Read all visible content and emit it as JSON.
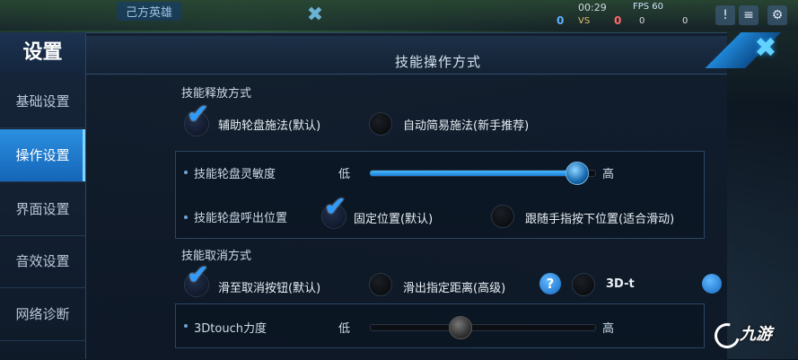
{
  "hud": {
    "ally_text": "己方英雄",
    "time": "00:29",
    "vs": "VS",
    "fps": "FPS 60",
    "score_blue": "0",
    "score_red": "0",
    "stat_a": "0",
    "stat_b": "0"
  },
  "settings": {
    "title": "设置",
    "close_icon": "close-icon",
    "nav": [
      {
        "label": "基础设置"
      },
      {
        "label": "操作设置",
        "active": true
      },
      {
        "label": "界面设置"
      },
      {
        "label": "音效设置"
      },
      {
        "label": "网络诊断"
      }
    ]
  },
  "content": {
    "section_title": "技能操作方式",
    "release": {
      "label": "技能释放方式",
      "option_1": "辅助轮盘施法(默认)",
      "option_1_checked": true,
      "option_2": "自动简易施法(新手推荐)",
      "option_2_checked": false
    },
    "sensitivity": {
      "label": "技能轮盘灵敏度",
      "low": "低",
      "high": "高",
      "value": 0.92
    },
    "position": {
      "label": "技能轮盘呼出位置",
      "option_1": "固定位置(默认)",
      "option_1_checked": true,
      "option_2": "跟随手指按下位置(适合滑动)",
      "option_2_checked": false
    },
    "cancel": {
      "label": "技能取消方式",
      "option_1": "滑至取消按钮(默认)",
      "option_1_checked": true,
      "option_2": "滑出指定距离(高级)",
      "option_2_checked": false,
      "help": "?",
      "option_3": "3D-t"
    },
    "touch_force": {
      "label": "3Dtouch力度",
      "low": "低",
      "high": "高",
      "value": 0.4
    }
  },
  "watermark": "九游",
  "colors": {
    "accent": "#2b8fe0",
    "panel": "#121e2e",
    "check": "#2e9bff"
  }
}
